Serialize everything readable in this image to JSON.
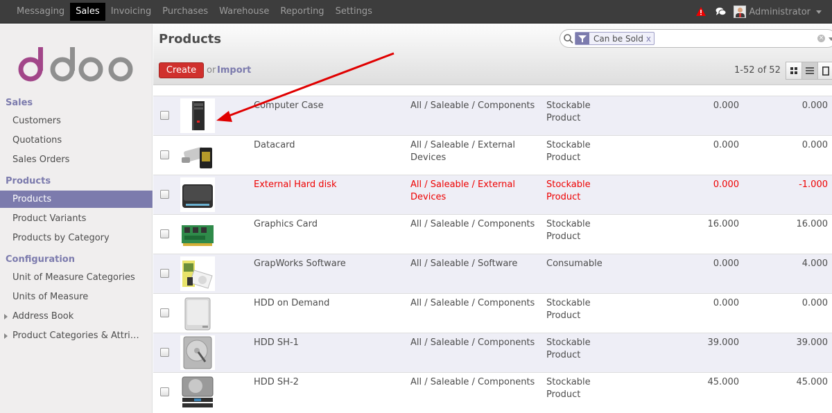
{
  "topbar": {
    "menu": [
      "Messaging",
      "Sales",
      "Invoicing",
      "Purchases",
      "Warehouse",
      "Reporting",
      "Settings"
    ],
    "active": "Sales",
    "user": "Administrator"
  },
  "sidebar": {
    "sections": {
      "sales": "Sales",
      "products": "Products",
      "configuration": "Configuration"
    },
    "items": {
      "customers": "Customers",
      "quotations": "Quotations",
      "sales_orders": "Sales Orders",
      "products": "Products",
      "product_variants": "Product Variants",
      "products_by_category": "Products by Category",
      "uom_categories": "Unit of Measure Categories",
      "uom": "Units of Measure",
      "address_book": "Address Book",
      "product_categories": "Product Categories & Attri…"
    }
  },
  "header": {
    "title": "Products",
    "create": "Create",
    "or": "or",
    "import": "Import",
    "pager": "1-52 of 52"
  },
  "search": {
    "facet": "Can be Sold",
    "facet_remove": "x"
  },
  "colors": {
    "accent": "#7c7bad",
    "create": "#d0302d",
    "negative": "#e00000"
  },
  "rows": [
    {
      "name": "Computer Case",
      "categ1": "All / Saleable / Components",
      "categ2": "",
      "type1": "Stockable",
      "type2": "Product",
      "qoh": "0.000",
      "forecast": "0.000",
      "icon": "computer-case-image"
    },
    {
      "name": "Datacard",
      "categ1": "All / Saleable / External",
      "categ2": "Devices",
      "type1": "Stockable",
      "type2": "Product",
      "qoh": "0.000",
      "forecast": "0.000",
      "icon": "datacard-image"
    },
    {
      "name": "External Hard disk",
      "categ1": "All / Saleable / External",
      "categ2": "Devices",
      "type1": "Stockable",
      "type2": "Product",
      "qoh": "0.000",
      "forecast": "-1.000",
      "icon": "external-hard-disk-image"
    },
    {
      "name": "Graphics Card",
      "categ1": "All / Saleable / Components",
      "categ2": "",
      "type1": "Stockable",
      "type2": "Product",
      "qoh": "16.000",
      "forecast": "16.000",
      "icon": "graphics-card-image"
    },
    {
      "name": "GrapWorks Software",
      "categ1": "All / Saleable / Software",
      "categ2": "",
      "type1": "Consumable",
      "type2": "",
      "qoh": "0.000",
      "forecast": "4.000",
      "icon": "software-box-image"
    },
    {
      "name": "HDD on Demand",
      "categ1": "All / Saleable / Components",
      "categ2": "",
      "type1": "Stockable",
      "type2": "Product",
      "qoh": "0.000",
      "forecast": "0.000",
      "icon": "hdd-image"
    },
    {
      "name": "HDD SH-1",
      "categ1": "All / Saleable / Components",
      "categ2": "",
      "type1": "Stockable",
      "type2": "Product",
      "qoh": "39.000",
      "forecast": "39.000",
      "icon": "hdd-open-image"
    },
    {
      "name": "HDD SH-2",
      "categ1": "All / Saleable / Components",
      "categ2": "",
      "type1": "Stockable",
      "type2": "Product",
      "qoh": "45.000",
      "forecast": "45.000",
      "icon": "hdd-stack-image"
    }
  ]
}
